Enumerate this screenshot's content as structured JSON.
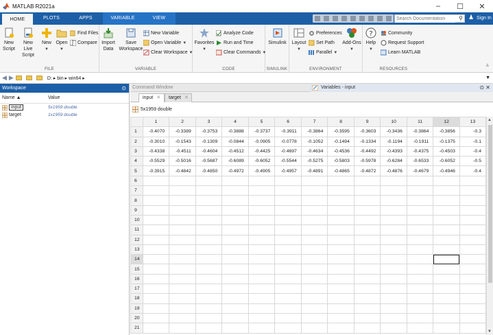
{
  "window": {
    "title": "MATLAB R2021a",
    "minimize": "–",
    "maximize": "☐",
    "close": "✕"
  },
  "ribbon_tabs": [
    "HOME",
    "PLOTS",
    "APPS",
    "VARIABLE",
    "VIEW"
  ],
  "search": {
    "placeholder": "Search Documentation"
  },
  "signin": "Sign In",
  "toolstrip": {
    "file": {
      "label": "FILE",
      "new_script": [
        "New",
        "Script"
      ],
      "new_live_script": [
        "New",
        "Live Script"
      ],
      "new": "New",
      "open": "Open",
      "find_files": "Find Files",
      "compare": "Compare"
    },
    "variable": {
      "label": "VARIABLE",
      "import_data": [
        "Import",
        "Data"
      ],
      "save_workspace": [
        "Save",
        "Workspace"
      ],
      "new_variable": "New Variable",
      "open_variable": "Open Variable",
      "clear_workspace": "Clear Workspace"
    },
    "code": {
      "label": "CODE",
      "favorites": "Favorites",
      "analyze_code": "Analyze Code",
      "run_and_time": "Run and Time",
      "clear_commands": "Clear Commands"
    },
    "simulink": {
      "label": "SIMULINK",
      "simulink": "Simulink"
    },
    "environment": {
      "label": "ENVIRONMENT",
      "layout": "Layout",
      "preferences": "Preferences",
      "set_path": "Set Path",
      "parallel": "Parallel",
      "addons": "Add-Ons"
    },
    "resources": {
      "label": "RESOURCES",
      "help": "Help",
      "community": "Community",
      "request_support": "Request Support",
      "learn_matlab": "Learn MATLAB"
    }
  },
  "address": {
    "path": "D: ▸ bin ▸ win64 ▸"
  },
  "workspace": {
    "title": "Workspace",
    "col_name": "Name ▲",
    "col_value": "Value",
    "vars": [
      {
        "name": "input",
        "value": "5x1959 double"
      },
      {
        "name": "target",
        "value": "1x1959 double"
      }
    ]
  },
  "command_window": {
    "title": "Command Window"
  },
  "variables_panel": {
    "title": "Variables - input"
  },
  "doc_tabs": [
    "input",
    "target"
  ],
  "var_info": "5x1959 double",
  "grid": {
    "columns": [
      "1",
      "2",
      "3",
      "4",
      "5",
      "6",
      "7",
      "8",
      "9",
      "10",
      "11",
      "12",
      "13"
    ],
    "row_numbers": [
      "1",
      "2",
      "3",
      "4",
      "5",
      "6",
      "7",
      "8",
      "9",
      "10",
      "11",
      "12",
      "13",
      "14",
      "15",
      "16",
      "17",
      "18",
      "19",
      "20",
      "21"
    ],
    "rows": [
      [
        "-0.4070",
        "-0.3389",
        "-0.3753",
        "-0.3888",
        "-0.3737",
        "-0.3911",
        "-0.3864",
        "-0.3595",
        "-0.3603",
        "-0.3436",
        "-0.3864",
        "-0.3856",
        "-0.3"
      ],
      [
        "-0.3010",
        "-0.1543",
        "-0.1309",
        "-0.0844",
        "-0.0905",
        "-0.0778",
        "-0.1052",
        "-0.1494",
        "-0.1334",
        "-0.1194",
        "-0.1911",
        "-0.1375",
        "-0.1"
      ],
      [
        "-0.4338",
        "-0.4511",
        "-0.4604",
        "-0.4512",
        "-0.4425",
        "-0.4697",
        "-0.4634",
        "-0.4536",
        "-0.4492",
        "-0.4393",
        "-0.4375",
        "-0.4503",
        "-0.4"
      ],
      [
        "-0.5529",
        "-0.5016",
        "-0.5687",
        "-0.6089",
        "-0.6052",
        "-0.5544",
        "-0.5275",
        "-0.5803",
        "-0.5978",
        "-0.6284",
        "-0.6533",
        "-0.6052",
        "-0.5"
      ],
      [
        "-0.3915",
        "-0.4842",
        "-0.4850",
        "-0.4972",
        "-0.4905",
        "-0.4957",
        "-0.4891",
        "-0.4865",
        "-0.4872",
        "-0.4876",
        "-0.4679",
        "-0.4946",
        "-0.4"
      ]
    ]
  },
  "colors": {
    "ribbon_blue": "#1d5fa6",
    "variable_tab": "#2673c6",
    "toolstrip_bg": "#f5f5f5"
  }
}
